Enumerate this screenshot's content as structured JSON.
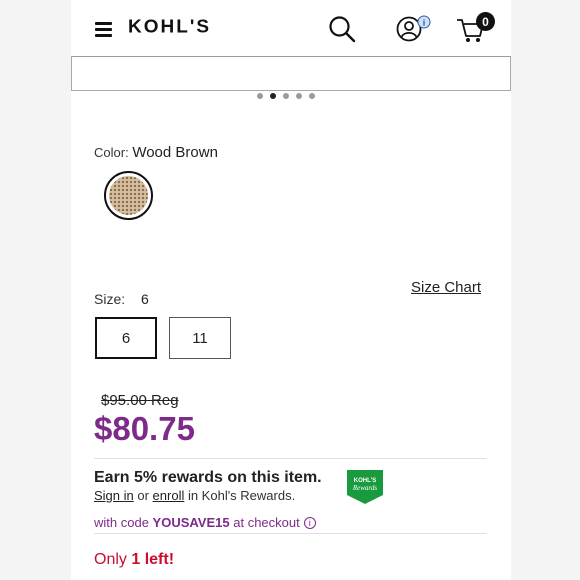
{
  "header": {
    "logo": "KOHL'S",
    "cart_count": "0"
  },
  "carousel": {
    "dot_count": 5,
    "active_index": 1
  },
  "color": {
    "label": "Color:",
    "value": "Wood Brown",
    "swatch_icon": "wood-weave-swatch"
  },
  "size": {
    "label": "Size:",
    "value": "6",
    "chart_link": "Size Chart",
    "options": [
      "6",
      "11"
    ],
    "selected": "6"
  },
  "price": {
    "regular": "$95.00 Reg",
    "sale": "$80.75"
  },
  "rewards": {
    "title": "Earn 5% rewards on this item.",
    "sign_in": "Sign in",
    "or": " or ",
    "enroll": "enroll",
    "suffix": " in Kohl's Rewards.",
    "badge_text_top": "KOHL'S",
    "badge_text_bottom": "Rewards"
  },
  "promo": {
    "prefix": "with code ",
    "code": "YOUSAVE15",
    "suffix": " at checkout",
    "info": "i"
  },
  "stock": {
    "prefix": "Only ",
    "count_text": "1 left!"
  },
  "colors": {
    "brand_purple": "#7e2a8a",
    "stock_red": "#c8102e",
    "rewards_green": "#1a9a3f"
  }
}
